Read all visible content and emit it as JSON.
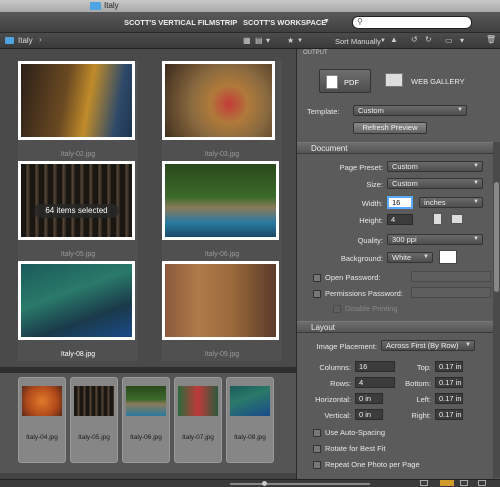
{
  "window": {
    "title": "Italy"
  },
  "toolbar": {
    "workspace_filmstrip": "SCOTT'S VERTICAL FILMSTRIP",
    "workspace_active": "SCOTT'S WORKSPACE",
    "search_placeholder": ""
  },
  "pathbar": {
    "folder": "Italy",
    "sort_label": "Sort Manually"
  },
  "content": {
    "thumbnails": [
      {
        "caption": "Italy-02.jpg"
      },
      {
        "caption": "Italy-03.jpg"
      },
      {
        "caption": "Italy-05.jpg"
      },
      {
        "caption": "Italy-06.jpg"
      },
      {
        "caption": "Italy-08.jpg"
      },
      {
        "caption": "Italy-09.jpg"
      }
    ],
    "selection_message": "64 items selected"
  },
  "filmstrip": {
    "items": [
      {
        "caption": "Italy-04.jpg"
      },
      {
        "caption": "Italy-05.jpg"
      },
      {
        "caption": "Italy-06.jpg"
      },
      {
        "caption": "Italy-07.jpg"
      },
      {
        "caption": "Italy-08.jpg"
      }
    ]
  },
  "output": {
    "header": "OUTPUT",
    "pdf_label": "PDF",
    "web_gallery_label": "WEB GALLERY",
    "template_label": "Template:",
    "template_value": "Custom",
    "refresh_button": "Refresh Preview"
  },
  "document": {
    "header": "Document",
    "page_preset_label": "Page Preset:",
    "page_preset_value": "Custom",
    "size_label": "Size:",
    "size_value": "Custom",
    "width_label": "Width:",
    "width_value": "16",
    "units_value": "inches",
    "height_label": "Height:",
    "height_value": "4",
    "quality_label": "Quality:",
    "quality_value": "300 ppi",
    "background_label": "Background:",
    "background_value": "White",
    "background_swatch": "#ffffff",
    "open_password_label": "Open Password:",
    "permissions_password_label": "Permissions Password:",
    "disable_printing_label": "Disable Printing"
  },
  "layout": {
    "header": "Layout",
    "image_placement_label": "Image Placement:",
    "image_placement_value": "Across First (By Row)",
    "columns_label": "Columns:",
    "columns_value": "16",
    "rows_label": "Rows:",
    "rows_value": "4",
    "horizontal_label": "Horizontal:",
    "horizontal_value": "0 in",
    "vertical_label": "Vertical:",
    "vertical_value": "0 in",
    "top_label": "Top:",
    "top_value": "0.17 in",
    "bottom_label": "Bottom:",
    "bottom_value": "0.17 in",
    "left_label": "Left:",
    "left_value": "0.17 in",
    "right_label": "Right:",
    "right_value": "0.17 in",
    "auto_spacing_label": "Use Auto-Spacing",
    "rotate_label": "Rotate for Best Fit",
    "repeat_label": "Repeat One Photo per Page"
  },
  "colors": {
    "accent_folder": "#4fa3e0",
    "focus_border": "#5aa9ff"
  }
}
